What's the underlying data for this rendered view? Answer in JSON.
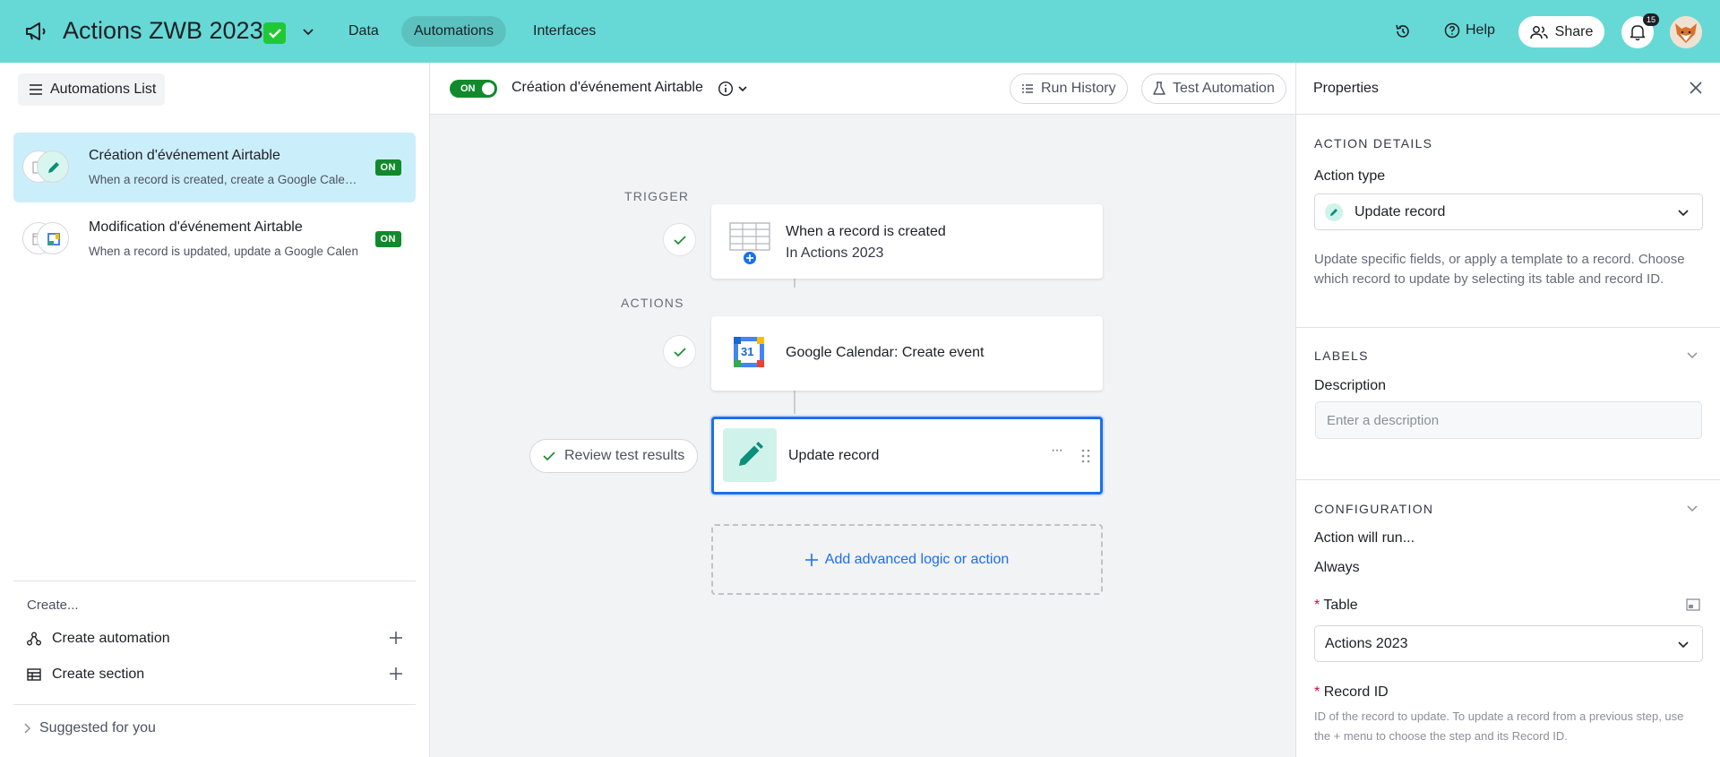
{
  "topbar": {
    "base_title": "Actions ZWB 2023",
    "tabs": [
      {
        "label": "Data"
      },
      {
        "label": "Automations"
      },
      {
        "label": "Interfaces"
      }
    ],
    "help_label": "Help",
    "share_label": "Share",
    "notification_count": "15",
    "bg_color": "#66d9d6"
  },
  "sidebar": {
    "list_button": "Automations List",
    "automations": [
      {
        "name": "Création d'événement Airtable",
        "desc": "When a record is created, create a Google Calendar event",
        "status": "ON"
      },
      {
        "name": "Modification d'événement Airtable",
        "desc": "When a record is updated, update a Google Calendar event",
        "status": "ON"
      }
    ],
    "create_header": "Create...",
    "create_automation": "Create automation",
    "create_section": "Create section",
    "suggested": "Suggested for you"
  },
  "main": {
    "toggle_label": "ON",
    "title": "Création d'événement Airtable",
    "run_history": "Run History",
    "test_automation": "Test Automation",
    "trigger_label": "TRIGGER",
    "actions_label": "ACTIONS",
    "trigger_step": {
      "title": "When a record is created",
      "sub": "In Actions 2023"
    },
    "action_steps": [
      {
        "title": "Google Calendar: Create event",
        "icon_text": "31"
      },
      {
        "title": "Update record"
      }
    ],
    "review_button": "Review test results",
    "add_button": "Add advanced logic or action",
    "more_icon": "···"
  },
  "panel": {
    "title": "Properties",
    "action_details": "ACTION DETAILS",
    "action_type_label": "Action type",
    "action_type_value": "Update record",
    "action_help": "Update specific fields, or apply a template to a record. Choose which record to update by selecting its table and record ID.",
    "labels_header": "LABELS",
    "description_label": "Description",
    "description_placeholder": "Enter a description",
    "configuration_header": "CONFIGURATION",
    "action_will_run": "Action will run...",
    "always": "Always",
    "table_label": "Table",
    "table_value": "Actions 2023",
    "record_id_label": "Record ID",
    "record_id_help": "ID of the record to update. To update a record from a previous step, use the + menu to choose the step and its Record ID.",
    "required_marker": "*"
  }
}
